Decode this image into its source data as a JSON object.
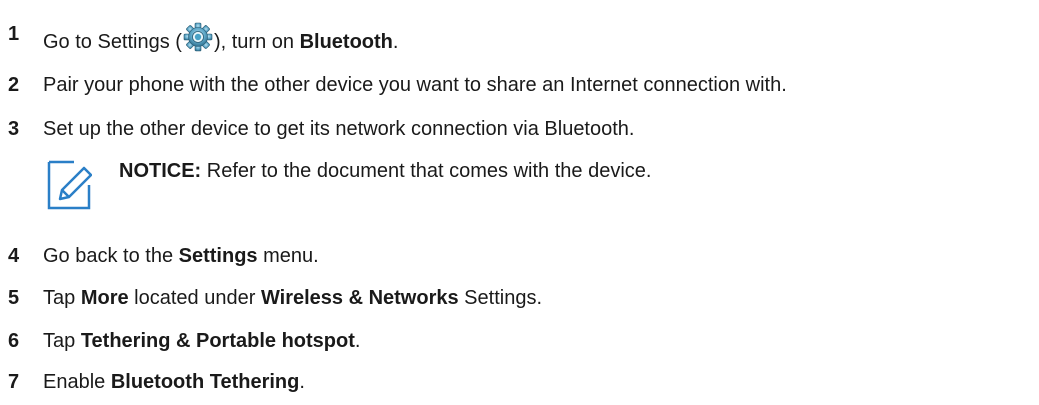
{
  "steps": [
    {
      "number": "1",
      "parts": {
        "a": "Go to Settings (",
        "b": "), turn on ",
        "c": "Bluetooth",
        "d": "."
      },
      "icon": "settings-gear-icon"
    },
    {
      "number": "2",
      "text": "Pair your phone with the other device you want to share an Internet connection with."
    },
    {
      "number": "3",
      "text": "Set up the other device to get its network connection via Bluetooth."
    },
    {
      "number": "4",
      "parts": {
        "a": "Go back to the ",
        "b": "Settings",
        "c": " menu."
      }
    },
    {
      "number": "5",
      "parts": {
        "a": "Tap ",
        "b": "More",
        "c": " located under ",
        "d": "Wireless & Networks",
        "e": " Settings."
      }
    },
    {
      "number": "6",
      "parts": {
        "a": "Tap ",
        "b": "Tethering & Portable hotspot",
        "c": "."
      }
    },
    {
      "number": "7",
      "parts": {
        "a": "Enable ",
        "b": "Bluetooth Tethering",
        "c": "."
      }
    }
  ],
  "notice": {
    "label": "NOTICE:",
    "text": " Refer to the document that comes with the device.",
    "icon": "edit-pencil-icon"
  }
}
